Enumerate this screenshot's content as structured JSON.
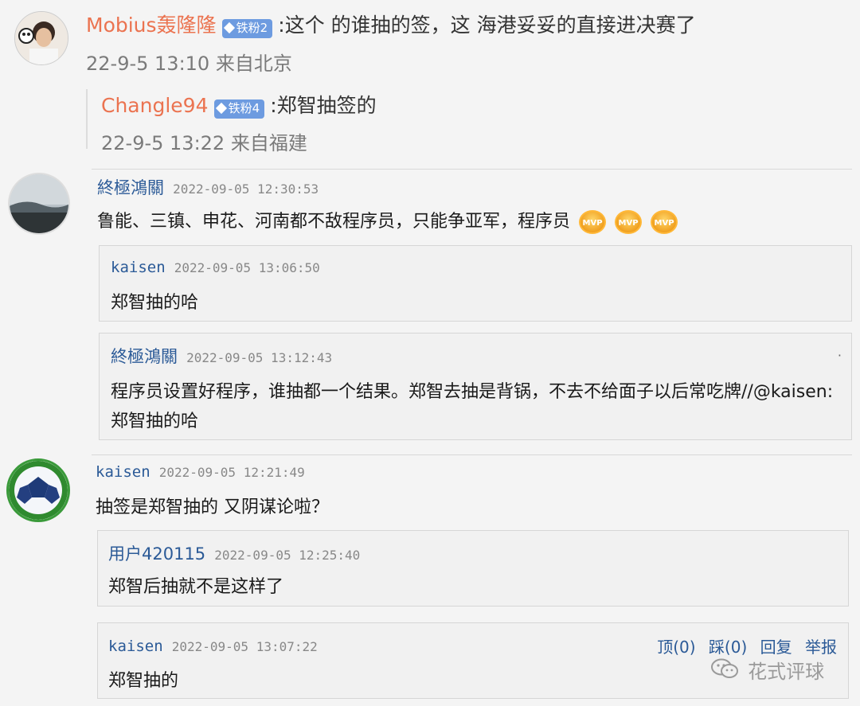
{
  "post1": {
    "username": "Mobius轰隆隆",
    "badge": "铁粉2",
    "text": ":这个 的谁抽的签，这 海港妥妥的直接进决赛了",
    "meta": "22-9-5 13:10 来自北京",
    "reply": {
      "username": "Changle94",
      "badge": "铁粉4",
      "text": ":郑智抽签的",
      "meta": "22-9-5 13:22 来自福建"
    }
  },
  "thread1": {
    "username": "終極鴻關",
    "date": "2022-09-05 12:30:53",
    "text": "鲁能、三镇、申花、河南都不敌程序员，只能争亚军，程序员",
    "mvp_label": "MVP",
    "quotes": [
      {
        "username": "kaisen",
        "date": "2022-09-05 13:06:50",
        "text": "郑智抽的哈"
      },
      {
        "username": "終極鴻關",
        "date": "2022-09-05 13:12:43",
        "text": "程序员设置好程序，谁抽都一个结果。郑智去抽是背锅，不去不给面子以后常吃牌//@kaisen:",
        "text2": "郑智抽的哈",
        "dot": "·"
      }
    ]
  },
  "thread2": {
    "username": "kaisen",
    "date": "2022-09-05 12:21:49",
    "text": "抽签是郑智抽的 又阴谋论啦？",
    "quotes": [
      {
        "username": "用户420115",
        "date": "2022-09-05 12:25:40",
        "text": "郑智后抽就不是这样了"
      },
      {
        "username": "kaisen",
        "date": "2022-09-05 13:07:22",
        "text": "郑智抽的"
      }
    ],
    "actions": {
      "top": "顶(0)",
      "down": "踩(0)",
      "reply": "回复",
      "report": "举报"
    }
  },
  "watermark": "花式评球",
  "colors": {
    "weibo_name": "#eb7350",
    "forum_name": "#2b5a97",
    "badge": "#6d9be0"
  }
}
